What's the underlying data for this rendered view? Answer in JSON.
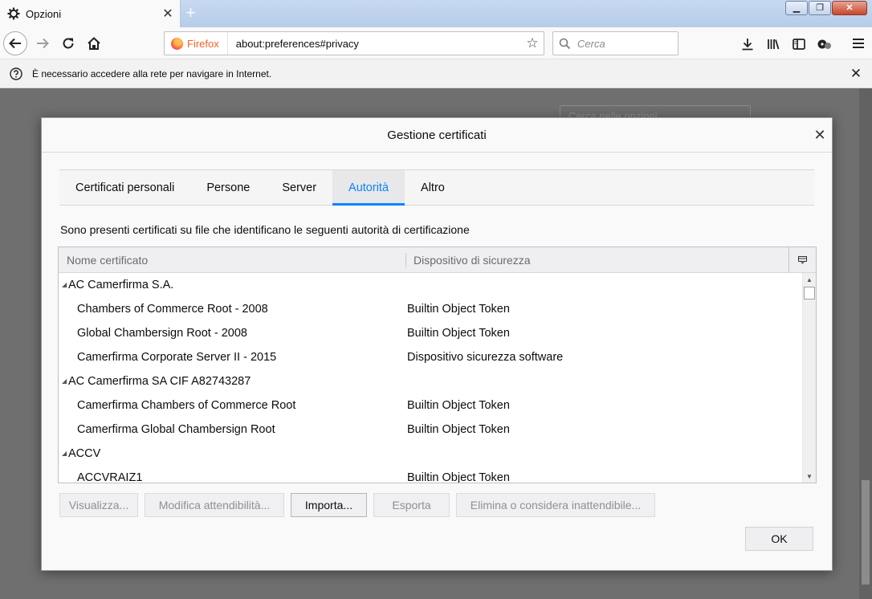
{
  "browser": {
    "tab_title": "Opzioni",
    "new_tab_icon": "plus-icon",
    "window_controls": [
      "minimize",
      "restore",
      "close"
    ],
    "identity_label": "Firefox",
    "url": "about:preferences#privacy",
    "search_placeholder": "Cerca"
  },
  "notification": {
    "message": "È necessario accedere alla rete per navigare in Internet."
  },
  "page": {
    "search_placeholder": "Cerca nelle opzioni"
  },
  "dialog": {
    "title": "Gestione certificati",
    "tabs": [
      {
        "label": "Certificati personali",
        "selected": false
      },
      {
        "label": "Persone",
        "selected": false
      },
      {
        "label": "Server",
        "selected": false
      },
      {
        "label": "Autorità",
        "selected": true
      },
      {
        "label": "Altro",
        "selected": false
      }
    ],
    "description": "Sono presenti certificati su file che identificano le seguenti autorità di certificazione",
    "columns": {
      "name": "Nome certificato",
      "device": "Dispositivo di sicurezza"
    },
    "rows": [
      {
        "type": "group",
        "name": "AC Camerfirma S.A.",
        "device": ""
      },
      {
        "type": "child",
        "name": "Chambers of Commerce Root - 2008",
        "device": "Builtin Object Token"
      },
      {
        "type": "child",
        "name": "Global Chambersign Root - 2008",
        "device": "Builtin Object Token"
      },
      {
        "type": "child",
        "name": "Camerfirma Corporate Server II - 2015",
        "device": "Dispositivo sicurezza software"
      },
      {
        "type": "group",
        "name": "AC Camerfirma SA CIF A82743287",
        "device": ""
      },
      {
        "type": "child",
        "name": "Camerfirma Chambers of Commerce Root",
        "device": "Builtin Object Token"
      },
      {
        "type": "child",
        "name": "Camerfirma Global Chambersign Root",
        "device": "Builtin Object Token"
      },
      {
        "type": "group",
        "name": "ACCV",
        "device": ""
      },
      {
        "type": "child",
        "name": "ACCVRAIZ1",
        "device": "Builtin Object Token"
      }
    ],
    "buttons": {
      "view": "Visualizza...",
      "edit_trust": "Modifica attendibilità...",
      "import": "Importa...",
      "export": "Esporta",
      "delete": "Elimina o considera inattendibile...",
      "ok": "OK"
    },
    "accent_color": "#0a84ff"
  }
}
